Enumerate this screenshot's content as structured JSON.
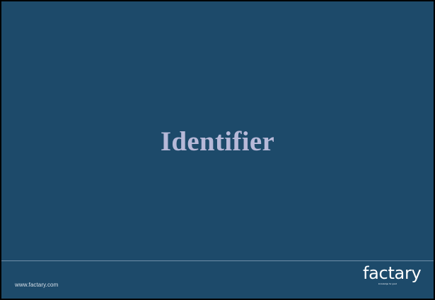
{
  "slide": {
    "title": "Identifier",
    "footer_url": "www.factary.com",
    "logo_text": "factary",
    "logo_tagline": "knowledge for good"
  },
  "colors": {
    "background": "#1d4a6a",
    "title": "#b7b9d8",
    "divider": "#6f8fa8",
    "footer_text": "#ffffff"
  }
}
